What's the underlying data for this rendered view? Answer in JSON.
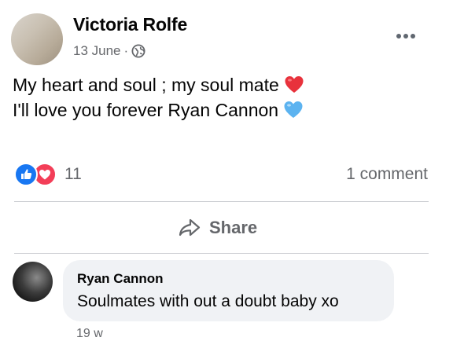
{
  "post": {
    "author": "Victoria Rolfe",
    "date": "13 June",
    "separator": "·",
    "privacy_icon": "globe-icon",
    "more_icon": "more-options-icon",
    "lines": [
      {
        "text": "My heart and soul ; my soul mate",
        "emoji": "red-heart-icon"
      },
      {
        "text": "I'll love you forever Ryan Cannon",
        "emoji": "blue-heart-icon"
      }
    ]
  },
  "reactions": {
    "icons": [
      "like-icon",
      "love-icon"
    ],
    "count": "11",
    "comments": "1 comment"
  },
  "actions": {
    "share_label": "Share",
    "share_icon": "share-icon"
  },
  "comment": {
    "author": "Ryan Cannon",
    "text": "Soulmates with out a doubt baby xo",
    "time": "19 w"
  },
  "colors": {
    "like_blue": "#1877f2",
    "love_red": "#f33e58",
    "heart_red": "#e8323c",
    "heart_blue": "#5cb3f0",
    "meta_gray": "#65676b",
    "bubble_bg": "#f0f2f5"
  }
}
